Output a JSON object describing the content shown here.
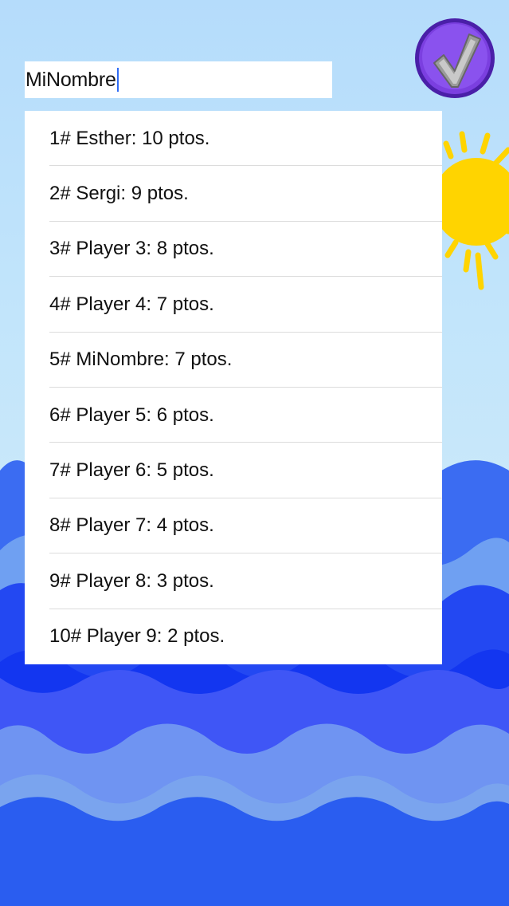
{
  "name_input": {
    "value": "MiNombre"
  },
  "confirm_button": {
    "icon": "checkmark-icon",
    "color": "#7b3fe0"
  },
  "scores": [
    "1# Esther: 10 ptos.",
    "2# Sergi: 9 ptos.",
    "3# Player 3: 8 ptos.",
    "4# Player 4: 7 ptos.",
    "5# MiNombre: 7 ptos.",
    "6# Player 5: 6 ptos.",
    "7# Player 6: 5 ptos.",
    "8# Player 7: 4 ptos.",
    "9# Player 8: 3 ptos.",
    "10# Player 9: 2 ptos."
  ],
  "colors": {
    "sky": "#bfe2fb",
    "sun": "#ffd400",
    "wave_light": "#6fa0f2",
    "wave_mid": "#3f56f6",
    "wave_deep": "#1f3df0",
    "caret": "#2f6cf5"
  }
}
